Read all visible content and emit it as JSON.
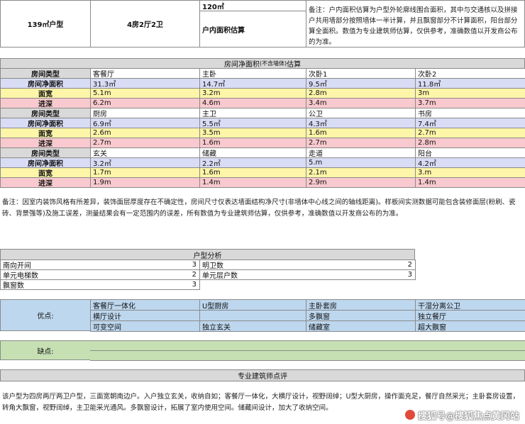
{
  "header": {
    "unit_type": "139㎡户型",
    "layout": "4房2厅2卫",
    "area_value": "120㎡",
    "area_label": "户内面积估算",
    "note": "备注：户内面积估算为户型外轮廓线围合面积，其中与交通核以及拼接户共用墙部分按照墙体一半计算，并且飘窗部分不计算面积，阳台部分算全面积。数值为专业建筑师估算，仅供参考，准确数值以开发商公布的为准。"
  },
  "rooms": {
    "title": "房间净面积",
    "title_small": "(不含墙体)",
    "title_suffix": "估算",
    "row_labels": {
      "type": "房间类型",
      "area": "房间净面积",
      "width": "面宽",
      "depth": "进深"
    },
    "groups": [
      {
        "names": [
          "客餐厅",
          "主卧",
          "次卧1",
          "次卧2"
        ],
        "areas": [
          "31.3㎡",
          "14.7㎡",
          "9.5㎡",
          "11.8㎡"
        ],
        "widths": [
          "5.1m",
          "3.2m",
          "2.8m",
          "3m"
        ],
        "depths": [
          "6.2m",
          "4.6m",
          "3.4m",
          "3.7m"
        ]
      },
      {
        "names": [
          "厨房",
          "主卫",
          "公卫",
          "书房"
        ],
        "areas": [
          "6.9㎡",
          "5.5㎡",
          "4.3㎡",
          "7.4㎡"
        ],
        "widths": [
          "2.6m",
          "3.5m",
          "1.6m",
          "2.7m"
        ],
        "depths": [
          "2.7m",
          "1.6m",
          "2.7m",
          "2.8m"
        ]
      },
      {
        "names": [
          "玄关",
          "储藏",
          "走道",
          "阳台"
        ],
        "areas": [
          "3.2㎡",
          "2.2㎡",
          "5.m",
          "4.2㎡"
        ],
        "widths": [
          "1.7m",
          "1.6m",
          "2.1m",
          "3.m"
        ],
        "depths": [
          "1.9m",
          "1.4m",
          "2.9m",
          "1.4m"
        ]
      }
    ],
    "note": "备注：因室内装饰风格有所差异，装饰面层厚度存在不确定性，房间尺寸仅表达墙面结构净尺寸(非墙体中心线之间的轴线距离)。样板间实测数据可能包含装修面层(粉刷、瓷砖、背景强等)及施工误差，测量结果会有一定范围内的误差，所有数值为专业建筑师估算，仅供参考，准确数值以开发商公布的为准。"
  },
  "analysis": {
    "title": "户型分析",
    "items": [
      {
        "label": "南向开间",
        "value": "3"
      },
      {
        "label": "明卫数",
        "value": "2"
      },
      {
        "label": "单元电梯数",
        "value": "2"
      },
      {
        "label": "单元层户数",
        "value": "3"
      },
      {
        "label": "飘窗数",
        "value": "3"
      }
    ]
  },
  "pros": {
    "label": "优点:",
    "rows": [
      [
        "客餐厅一体化",
        "U型厨房",
        "主卧套房",
        "干湿分离公卫"
      ],
      [
        "横厅设计",
        "",
        "多飘窗",
        "独立餐厅"
      ],
      [
        "可变空间",
        "独立玄关",
        "储藏室",
        "超大飘窗"
      ]
    ]
  },
  "cons": {
    "label": "缺点:"
  },
  "review": {
    "title": "专业建筑师点评",
    "text": "该户型为四房两厅两卫户型，三面宽朝南边户。入户独立玄关，收纳自如；客餐厅一体化，大横厅设计，视野阔绰；U型大厨房，操作面充足，餐厅自然采光；主卧套房设置，转角大飘窗，视野阔绰，主卫能采光通风。多飘窗设计，拓展了室内使用空间。储藏间设计，加大了收纳空间。"
  },
  "watermark": "搜狐号@搜狐焦点黄冈站",
  "colors": {
    "header_gray": "#d9d9d9",
    "area_row": "#d9dcf5",
    "width_row": "#fdf5a8",
    "depth_row": "#f8c9ce",
    "pros_blue": "#bdd7ee",
    "cons_green": "#c6e0b4"
  }
}
